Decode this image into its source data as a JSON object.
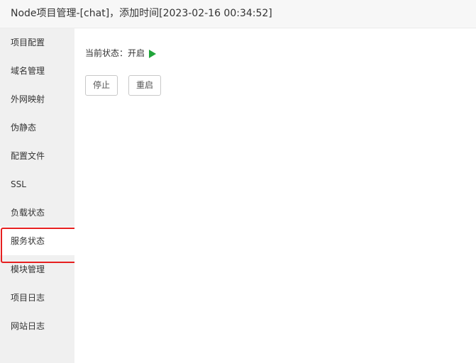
{
  "window": {
    "title": "Node项目管理-[chat]，添加时间[2023-02-16 00:34:52]"
  },
  "sidebar": {
    "items": [
      {
        "label": "项目配置"
      },
      {
        "label": "域名管理"
      },
      {
        "label": "外网映射"
      },
      {
        "label": "伪静态"
      },
      {
        "label": "配置文件"
      },
      {
        "label": "SSL"
      },
      {
        "label": "负载状态"
      },
      {
        "label": "服务状态",
        "active": true
      },
      {
        "label": "模块管理"
      },
      {
        "label": "项目日志"
      },
      {
        "label": "网站日志"
      }
    ],
    "highlight_color": "#e61f1f"
  },
  "main": {
    "status_prefix": "当前状态：",
    "status_value": "开启",
    "status_icon": "play-icon",
    "status_color": "#20a53a",
    "stop_label": "停止",
    "restart_label": "重启"
  }
}
